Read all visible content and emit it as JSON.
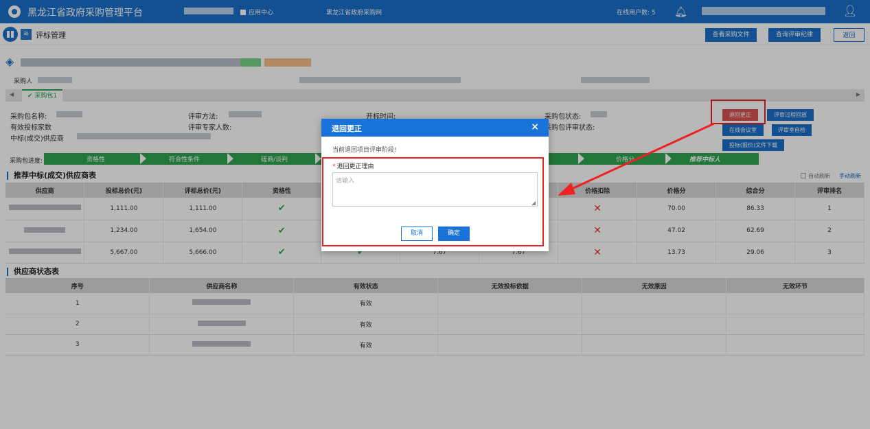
{
  "topbar": {
    "title": "黑龙江省政府采购管理平台",
    "app_center": "应用中心",
    "procurement_net": "黑龙江省政府采购网",
    "online_users": "在线用户数: 5"
  },
  "pagehead": {
    "title": "评标管理",
    "buttons": [
      "查看采购文件",
      "查询评审纪律",
      "返回"
    ]
  },
  "project": {
    "buyer_label": "采购人"
  },
  "tabs": {
    "package": "采购包1"
  },
  "package_info": {
    "name_label": "采购包名称:",
    "valid_bidders_label": "有效投标家数",
    "winner_label": "中标(成交)供应商",
    "eval_method_label": "评审方法:",
    "experts_label": "评审专家人数:",
    "open_time_label": "开标时间:",
    "status_label": "采购包状态:",
    "review_status_label": "采购包评审状态:"
  },
  "actions": {
    "return_correct": "退回更正",
    "review_playback": "评审过程回放",
    "online_meeting": "在线会议室",
    "self_check": "评审室自检",
    "download": "投标(报价)文件下载"
  },
  "progress": {
    "label": "采购包进度:",
    "steps": [
      "资格性",
      "符合性条件",
      "磋商/谈判",
      "",
      "",
      "价格分",
      "推荐中标人"
    ]
  },
  "recommend": {
    "title": "推荐中标(成交)供应商表",
    "auto_refresh": "自动刷新",
    "manual_refresh": "手动刷新",
    "headers": [
      "供应商",
      "投标总价(元)",
      "评标总价(元)",
      "资格性",
      "",
      "",
      "",
      "价格扣除",
      "价格分",
      "综合分",
      "评审排名"
    ],
    "rows": [
      {
        "bid": "1,111.00",
        "eval": "1,111.00",
        "c5": "",
        "c6": "",
        "price_score": "70.00",
        "total": "86.33",
        "rank": "1"
      },
      {
        "bid": "1,234.00",
        "eval": "1,654.00",
        "c5": "",
        "c6": "",
        "price_score": "47.02",
        "total": "62.69",
        "rank": "2"
      },
      {
        "bid": "5,667.00",
        "eval": "5,666.00",
        "c5": "7.67",
        "c6": "7.67",
        "price_score": "13.73",
        "total": "29.06",
        "rank": "3"
      }
    ]
  },
  "status_table": {
    "title": "供应商状态表",
    "headers": [
      "序号",
      "供应商名称",
      "有效状态",
      "无效投标依据",
      "无效原因",
      "无效环节"
    ],
    "rows": [
      {
        "no": "1",
        "status": "有效"
      },
      {
        "no": "2",
        "status": "有效"
      },
      {
        "no": "3",
        "status": "有效"
      }
    ]
  },
  "modal": {
    "title": "退回更正",
    "close": "×",
    "description": "当前退回项目评审阶段!",
    "field_label": "退回更正理由",
    "placeholder": "请输入",
    "cancel": "取消",
    "confirm": "确定"
  },
  "colors": {
    "primary": "#1a6fc9",
    "success": "#2fa44f",
    "danger": "#e22222"
  }
}
